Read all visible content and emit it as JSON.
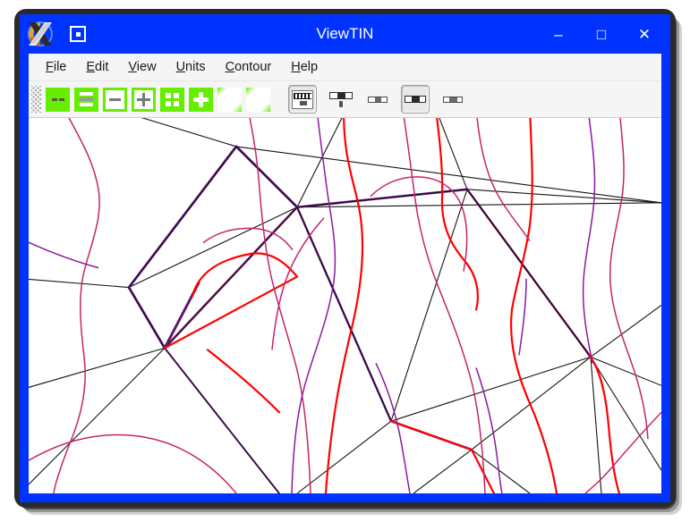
{
  "window": {
    "title": "ViewTIN",
    "app_icon": "x-logo-icon",
    "window_menu_icon": "window-menu-icon",
    "controls": {
      "minimize": "–",
      "maximize": "□",
      "close": "✕"
    },
    "frame_color": "#0033ff",
    "titlebar_text_color": "#ffffff"
  },
  "menubar": {
    "items": [
      {
        "label": "File",
        "mnemonic": "F",
        "rest": "ile"
      },
      {
        "label": "Edit",
        "mnemonic": "E",
        "rest": "dit"
      },
      {
        "label": "View",
        "mnemonic": "V",
        "rest": "iew"
      },
      {
        "label": "Units",
        "mnemonic": "U",
        "rest": "nits"
      },
      {
        "label": "Contour",
        "mnemonic": "C",
        "rest": "ontour"
      },
      {
        "label": "Help",
        "mnemonic": "H",
        "rest": "elp"
      }
    ]
  },
  "toolbar": {
    "accent_color": "#66ee00",
    "group1": [
      {
        "name": "zoom-fit-width-button",
        "icon": "two-dashes-icon",
        "style": "green-solid",
        "selected": false
      },
      {
        "name": "zoom-fit-button",
        "icon": "stacked-bars-icon",
        "style": "green-solid",
        "selected": false
      },
      {
        "name": "zoom-out-button",
        "icon": "minus-icon",
        "style": "green-hollow",
        "selected": false
      },
      {
        "name": "zoom-in-button",
        "icon": "plus-icon",
        "style": "green-hollow",
        "selected": false
      },
      {
        "name": "grid-toggle-button",
        "icon": "grid-icon",
        "style": "green-solid",
        "selected": false
      },
      {
        "name": "center-view-button",
        "icon": "crosshair-icon",
        "style": "green-solid",
        "selected": false
      },
      {
        "name": "rotate-left-button",
        "icon": "rotate-left-icon",
        "style": "green-fade",
        "selected": false
      },
      {
        "name": "rotate-right-button",
        "icon": "rotate-right-icon",
        "style": "green-fade",
        "selected": false
      }
    ],
    "group2": [
      {
        "name": "scale-ruler-button",
        "icon": "ruler-icon",
        "style": "sunken",
        "selected": true
      },
      {
        "name": "scale-bar-button",
        "icon": "scale-bar-icon",
        "style": "plain",
        "selected": false
      },
      {
        "name": "scale-bar-small-button",
        "icon": "scale-bar-small-icon",
        "style": "plain",
        "selected": false
      },
      {
        "name": "scale-bar-boxed-button",
        "icon": "scale-bar-boxed-icon",
        "style": "sunken",
        "selected": true
      },
      {
        "name": "scale-bar-plain-button",
        "icon": "scale-bar-plain-icon",
        "style": "plain",
        "selected": false
      }
    ]
  },
  "canvas": {
    "name": "tin-contour-canvas",
    "background": "#ffffff",
    "colors": {
      "tin_edge": "#141414",
      "highlight_edge": "#5c1a6e",
      "contour_major": "#ff0000",
      "contour_minor": "#c4246a",
      "contour_purple": "#8a1a9e"
    },
    "description": "Triangulated irregular network with elevation contour lines"
  }
}
